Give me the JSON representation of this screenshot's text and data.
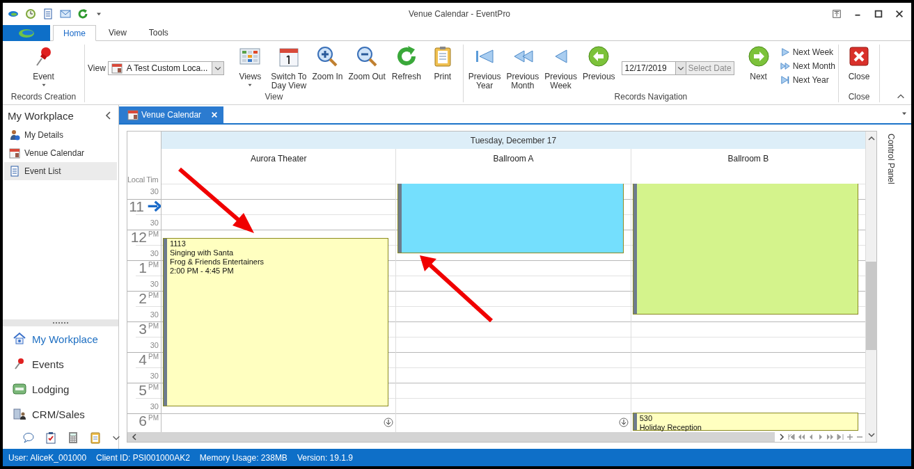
{
  "window": {
    "title": "Venue Calendar - EventPro"
  },
  "ribbon_tabs": [
    {
      "label": "Home",
      "selected": true
    },
    {
      "label": "View",
      "selected": false
    },
    {
      "label": "Tools",
      "selected": false
    }
  ],
  "ribbon_groups": [
    {
      "title": "Records Creation",
      "items": [
        {
          "kind": "large",
          "label": "Event",
          "dropdown": true
        }
      ]
    },
    {
      "title": "View",
      "items": [
        {
          "kind": "combo",
          "label": "View",
          "value": "A Test Custom Loca..."
        },
        {
          "kind": "large",
          "label": "Views",
          "dropdown": true
        },
        {
          "kind": "large",
          "label": "Switch To\nDay View"
        },
        {
          "kind": "large",
          "label": "Zoom In"
        },
        {
          "kind": "large",
          "label": "Zoom Out"
        },
        {
          "kind": "large",
          "label": "Refresh"
        },
        {
          "kind": "large",
          "label": "Print"
        }
      ]
    },
    {
      "title": "Records Navigation",
      "items": [
        {
          "kind": "large",
          "label": "Previous\nYear"
        },
        {
          "kind": "large",
          "label": "Previous\nMonth"
        },
        {
          "kind": "large",
          "label": "Previous\nWeek"
        },
        {
          "kind": "large",
          "label": "Previous"
        },
        {
          "kind": "date",
          "value": "12/17/2019",
          "button": "Select Date",
          "disabled": true
        },
        {
          "kind": "large",
          "label": "Next"
        },
        {
          "kind": "small",
          "label": "Next Week"
        },
        {
          "kind": "small",
          "label": "Next Month"
        },
        {
          "kind": "small",
          "label": "Next Year"
        }
      ]
    },
    {
      "title": "Close",
      "items": [
        {
          "kind": "large",
          "label": "Close"
        }
      ]
    }
  ],
  "sidebar": {
    "title": "My Workplace",
    "items": [
      {
        "label": "My Details",
        "selected": false
      },
      {
        "label": "Venue Calendar",
        "selected": false
      },
      {
        "label": "Event List",
        "selected": true
      }
    ],
    "nav": [
      {
        "label": "My Workplace",
        "selected": true
      },
      {
        "label": "Events",
        "selected": false
      },
      {
        "label": "Lodging",
        "selected": false
      },
      {
        "label": "CRM/Sales",
        "selected": false
      }
    ]
  },
  "document_tabs": [
    {
      "label": "Venue Calendar",
      "selected": true
    }
  ],
  "calendar": {
    "date": "Tuesday, December 17",
    "time_header": "Local Tim",
    "time_slots": [
      {
        "minute": "30"
      },
      {
        "hour": "11"
      },
      {
        "minute": "30"
      },
      {
        "hour": "12",
        "suffix": "PM"
      },
      {
        "minute": "30"
      },
      {
        "hour": "1",
        "suffix": "PM"
      },
      {
        "minute": "30"
      },
      {
        "hour": "2",
        "suffix": "PM"
      },
      {
        "minute": "30"
      },
      {
        "hour": "3",
        "suffix": "PM"
      },
      {
        "minute": "30"
      },
      {
        "hour": "4",
        "suffix": "PM"
      },
      {
        "minute": "30"
      },
      {
        "hour": "5",
        "suffix": "PM"
      },
      {
        "minute": "30"
      },
      {
        "hour": "6",
        "suffix": "PM"
      }
    ],
    "resources": [
      {
        "name": "Aurora Theater",
        "more_below": true,
        "events": [
          {
            "color": "#ffffc0",
            "lines": [
              "1113",
              "Singing with Santa",
              "Frog & Friends Entertainers",
              "2:00 PM - 4:45 PM"
            ]
          }
        ]
      },
      {
        "name": "Ballroom A",
        "more_below": true,
        "events": [
          {
            "color": "#74dffd"
          }
        ]
      },
      {
        "name": "Ballroom B",
        "more_below": false,
        "events": [
          {
            "color": "#d4f38c"
          },
          {
            "color": "#ffffc0",
            "lines": [
              "530",
              "Holiday Reception"
            ]
          }
        ]
      }
    ]
  },
  "control_panel": {
    "label": "Control Panel"
  },
  "status_bar": [
    "User: AliceK_001000",
    "Client ID: PSI001000AK2",
    "Memory Usage: 238MB",
    "Version: 19.1.9"
  ]
}
